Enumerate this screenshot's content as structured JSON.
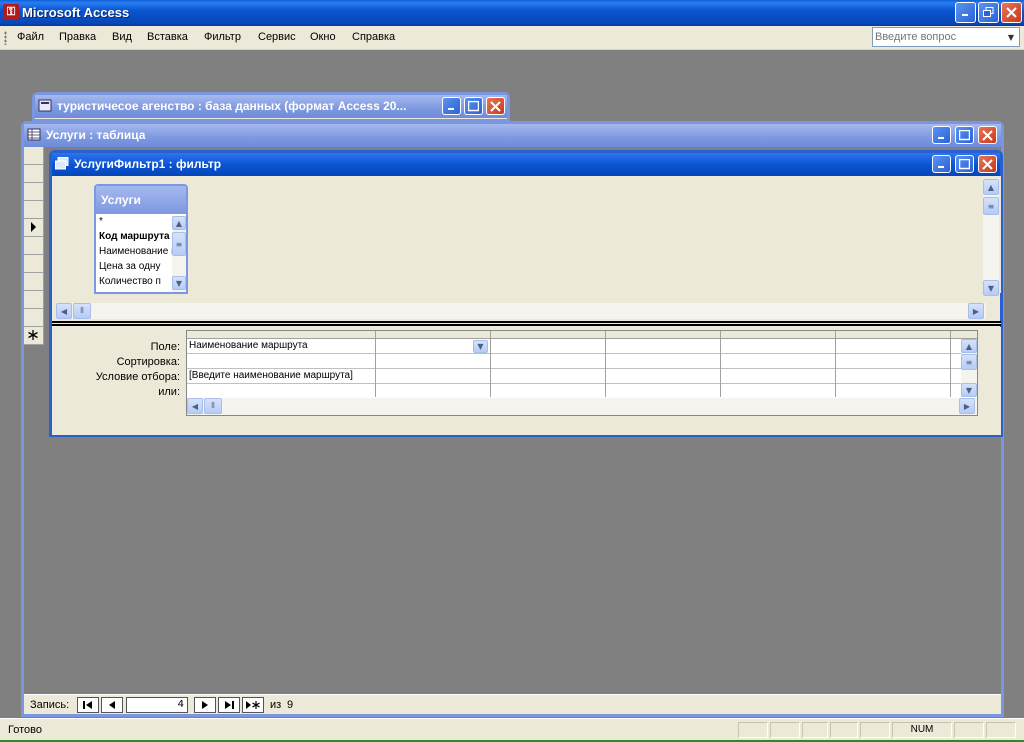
{
  "app": {
    "title": "Microsoft Access",
    "icon": "access-key-icon"
  },
  "menu": [
    {
      "label": "Файл"
    },
    {
      "label": "Правка"
    },
    {
      "label": "Вид"
    },
    {
      "label": "Вставка"
    },
    {
      "label": "Фильтр"
    },
    {
      "label": "Сервис"
    },
    {
      "label": "Окно"
    },
    {
      "label": "Справка"
    }
  ],
  "help": {
    "placeholder": "Введите вопрос"
  },
  "db_window": {
    "title": "туристичесое агенство : база данных (формат Access 20..."
  },
  "table_window": {
    "title": "Услуги : таблица",
    "record_nav": {
      "label": "Запись:",
      "current": "4",
      "of_label": "из",
      "total": "9"
    }
  },
  "filter_window": {
    "title": "УслугиФильтр1 : фильтр",
    "field_list": {
      "title": "Услуги",
      "items": [
        "*",
        "Код маршрута",
        "Наименование маршрута",
        "Цена за одну",
        "Количество п"
      ]
    },
    "grid": {
      "row_labels": [
        "Поле:",
        "Сортировка:",
        "Условие отбора:",
        "или:"
      ],
      "columns": [
        {
          "field": "Наименование маршрута",
          "sort": "",
          "criteria": "[Введите наименование маршрута]",
          "or": ""
        },
        {
          "field": "",
          "sort": "",
          "criteria": "",
          "or": ""
        },
        {
          "field": "",
          "sort": "",
          "criteria": "",
          "or": ""
        },
        {
          "field": "",
          "sort": "",
          "criteria": "",
          "or": ""
        },
        {
          "field": "",
          "sort": "",
          "criteria": "",
          "or": ""
        },
        {
          "field": "",
          "sort": "",
          "criteria": "",
          "or": ""
        },
        {
          "field": "",
          "sort": "",
          "criteria": "",
          "or": ""
        }
      ]
    }
  },
  "status": {
    "text": "Готово",
    "num": "NUM"
  },
  "colors": {
    "title_active": "#0a55d0",
    "title_inactive": "#7d98e0",
    "face": "#ece9d8",
    "mdi_bg": "#808080"
  }
}
